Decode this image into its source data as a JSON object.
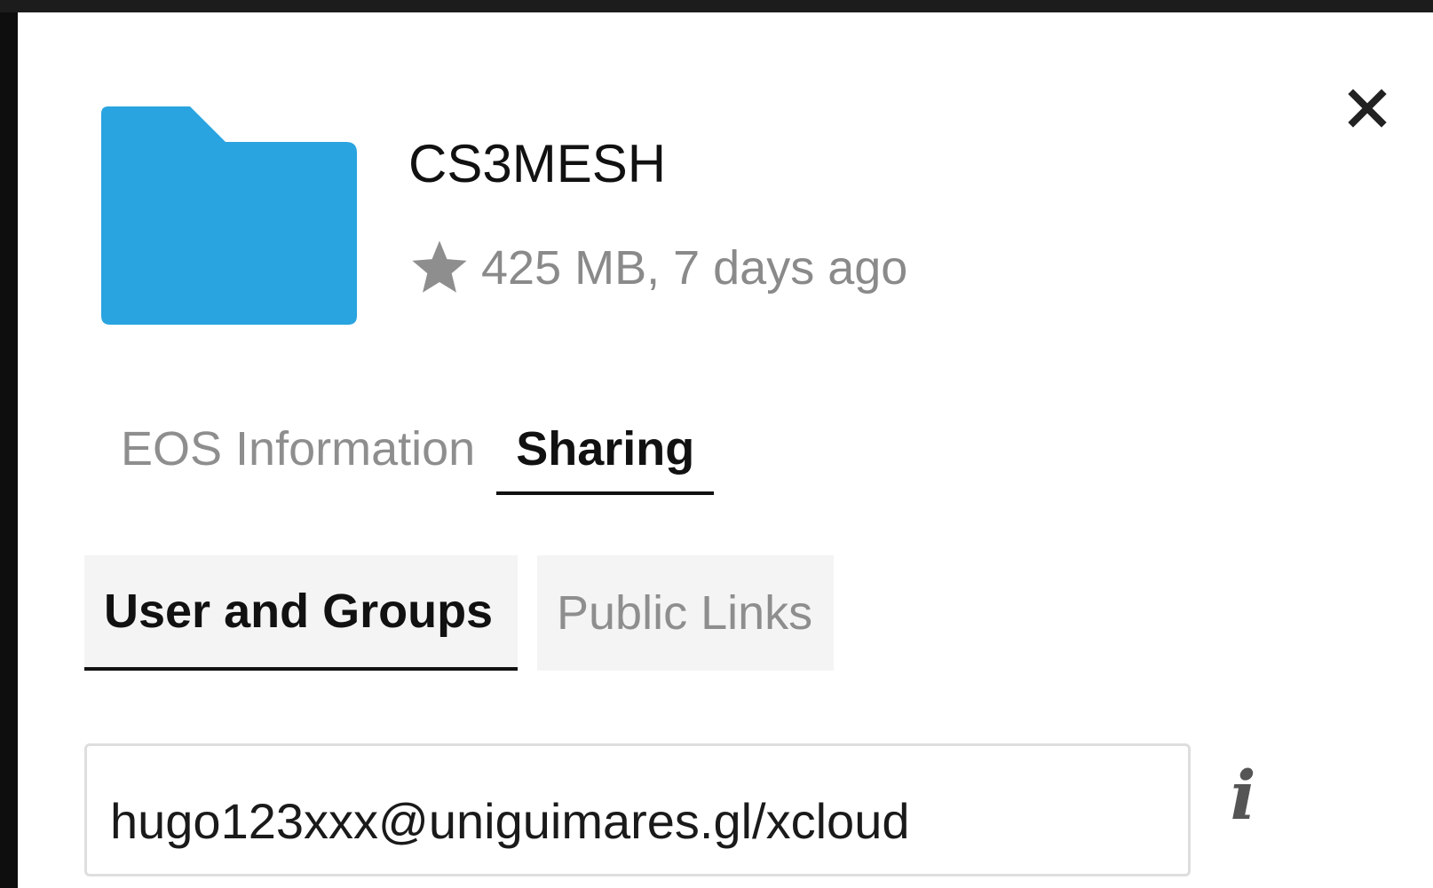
{
  "file": {
    "name": "CS3MESH",
    "meta": "425 MB, 7 days ago",
    "icon": "folder-icon",
    "favorite_icon": "star-icon",
    "folder_color": "#29a4e0"
  },
  "tabs": [
    {
      "label": "EOS Information",
      "active": false
    },
    {
      "label": "Sharing",
      "active": true
    }
  ],
  "sharing": {
    "subtabs": [
      {
        "label": "User and Groups",
        "active": true
      },
      {
        "label": "Public Links",
        "active": false
      }
    ],
    "share_input": {
      "value": "hugo123xxx@uniguimares.gl/xcloud",
      "placeholder": ""
    },
    "info_icon_glyph": "i"
  },
  "close_icon": "close-icon",
  "colors": {
    "accent": "#29a4e0",
    "active_text": "#111111",
    "muted_text": "#8a8a8a",
    "subtab_bg": "#f4f4f4"
  }
}
